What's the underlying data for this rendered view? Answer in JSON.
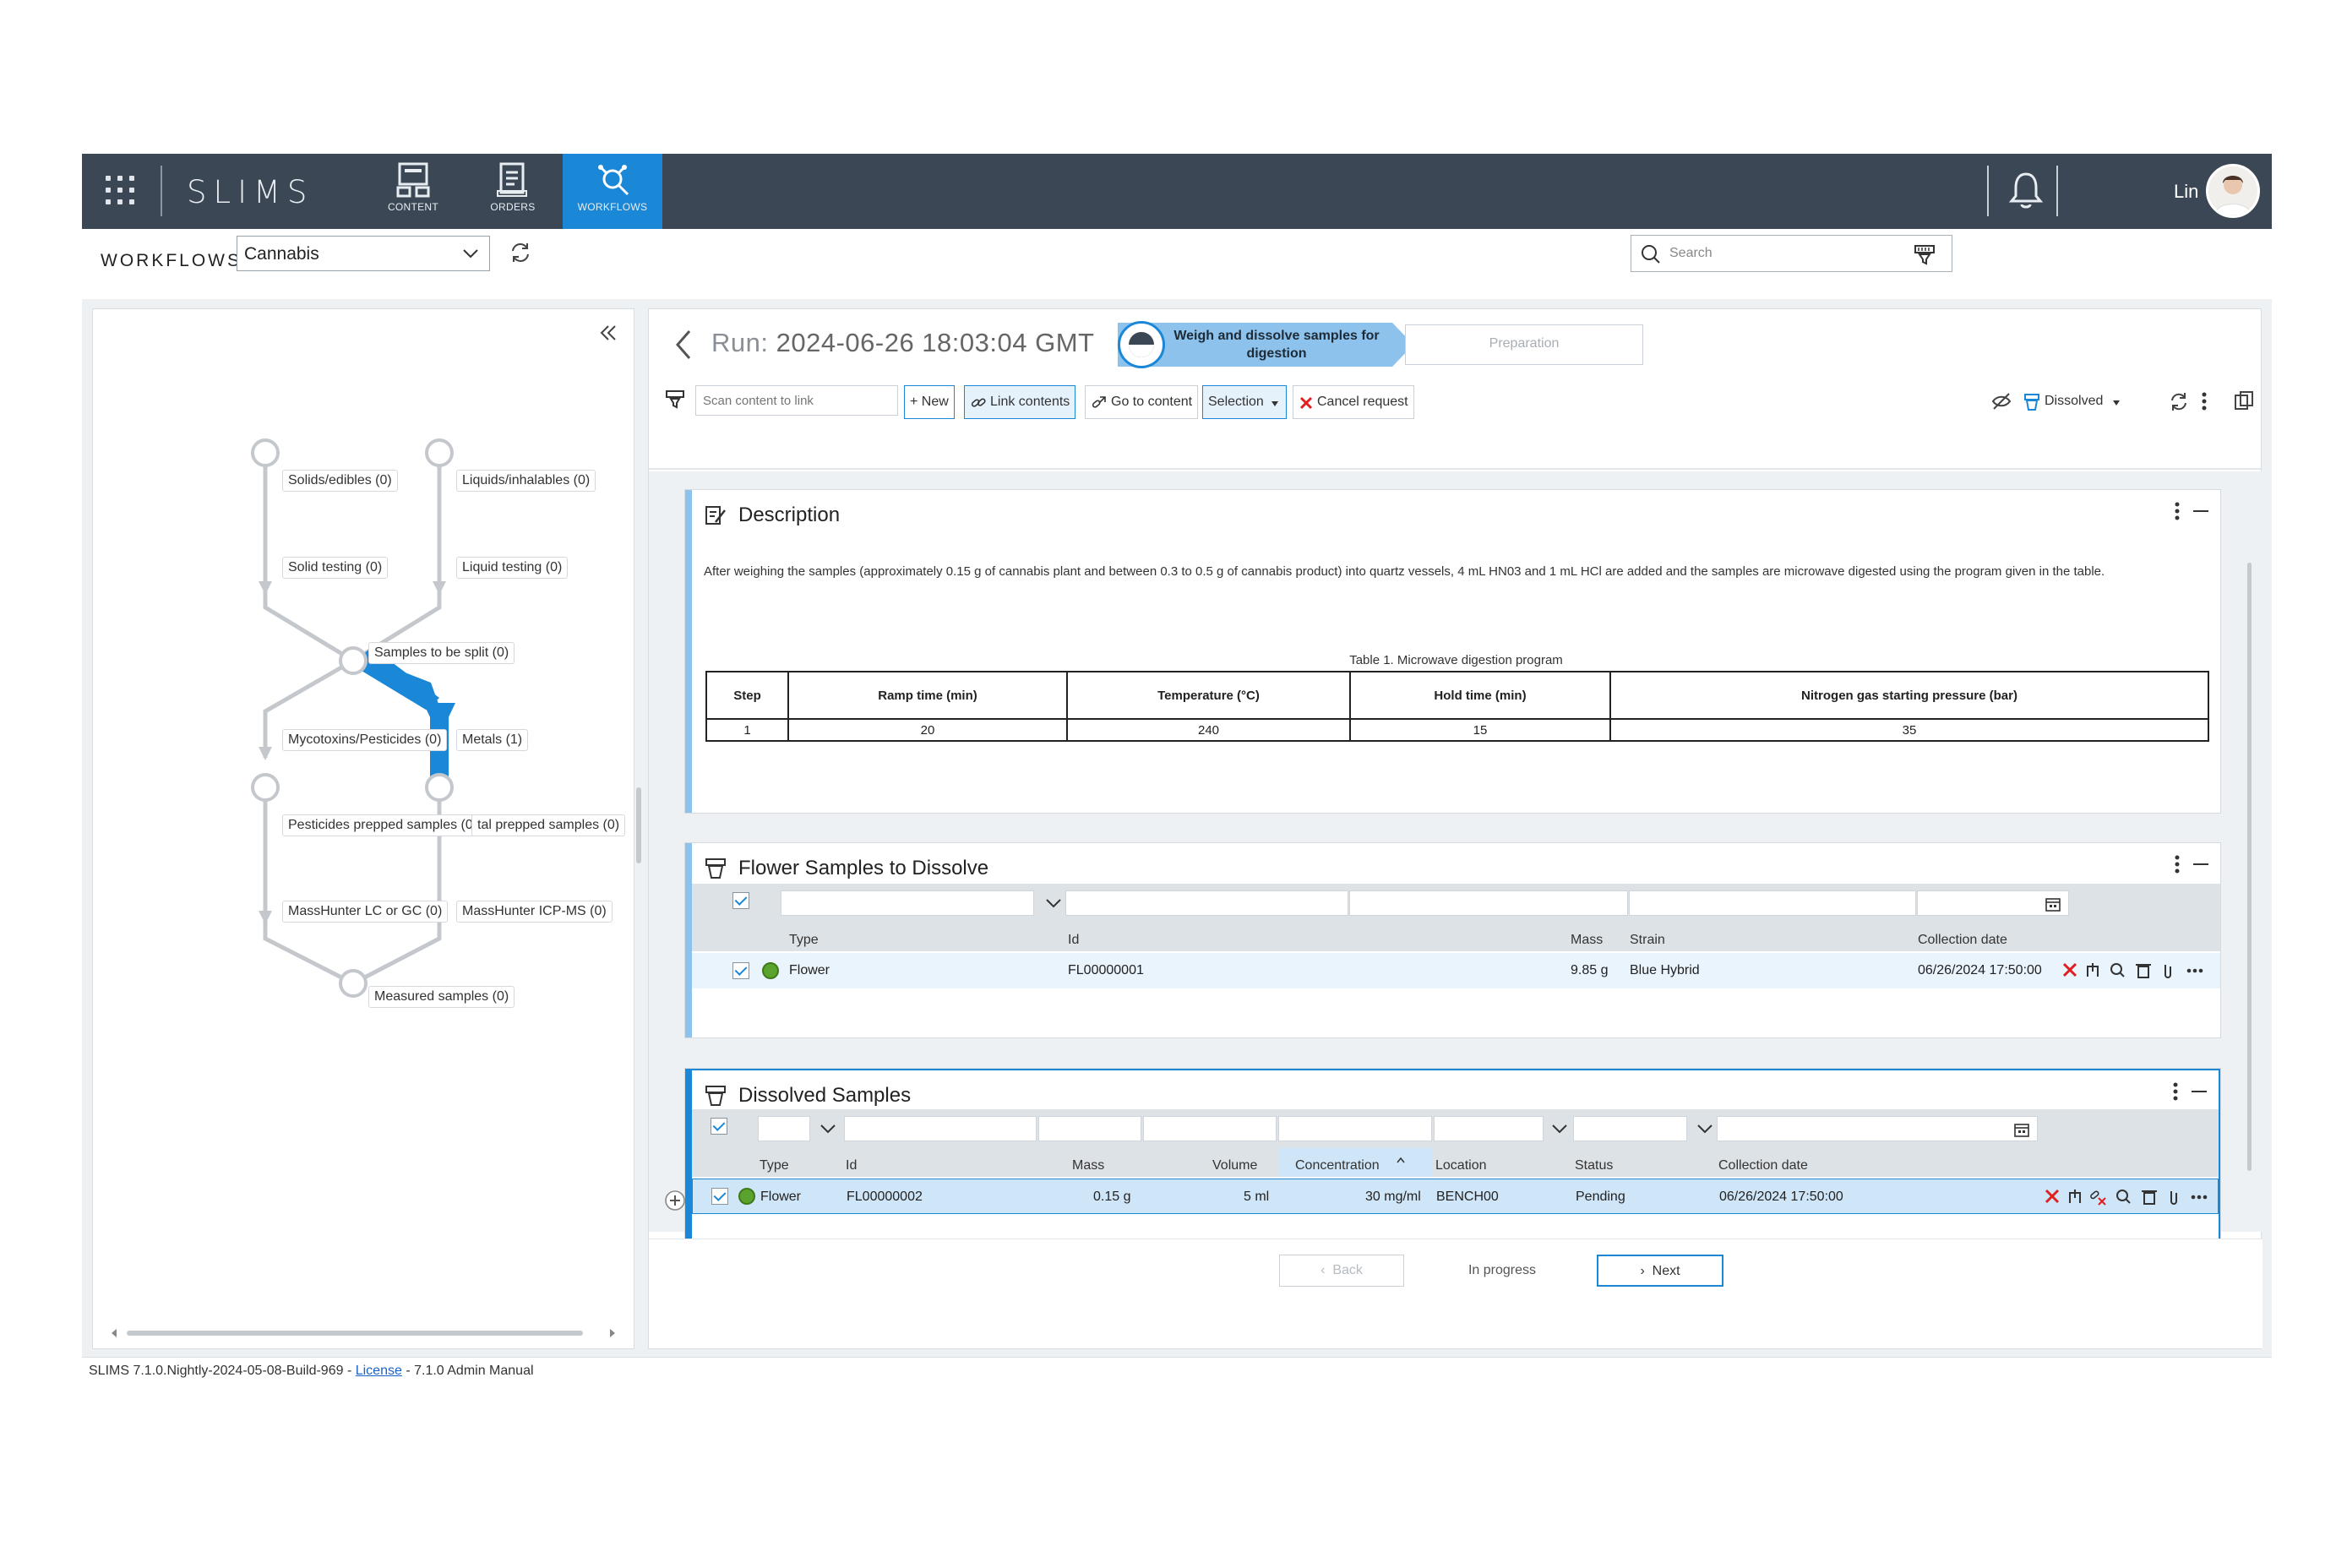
{
  "topbar": {
    "brand": "SLIMS",
    "tabs": [
      {
        "label": "CONTENT",
        "icon": "content-icon"
      },
      {
        "label": "ORDERS",
        "icon": "orders-icon"
      },
      {
        "label": "WORKFLOWS",
        "icon": "workflows-icon"
      }
    ],
    "active_tab": "WORKFLOWS",
    "user_name": "Lin"
  },
  "subheader": {
    "label": "WORKFLOWS",
    "selected_workflow": "Cannabis",
    "search_placeholder": "Search"
  },
  "workflow_graph": {
    "nodes": [
      {
        "label": "Solids/edibles (0)"
      },
      {
        "label": "Liquids/inhalables (0)"
      },
      {
        "label": "Solid testing (0)"
      },
      {
        "label": "Liquid testing (0)"
      },
      {
        "label": "Samples to be split (0)"
      },
      {
        "label": "Mycotoxins/Pesticides (0)"
      },
      {
        "label": "Metals (1)"
      },
      {
        "label": "Pesticides prepped samples (0)"
      },
      {
        "label": "tal prepped samples (0)"
      },
      {
        "label": "MassHunter LC or GC (0)"
      },
      {
        "label": "MassHunter ICP-MS (0)"
      },
      {
        "label": "Measured samples (0)"
      }
    ]
  },
  "run": {
    "prefix": "Run:",
    "datetime": "2024-06-26 18:03:04 GMT",
    "current_step": "Weigh and dissolve samples for digestion",
    "next_step": "Preparation"
  },
  "toolbar": {
    "scan_placeholder": "Scan content to link",
    "new_label": "+ New",
    "link_contents_label": "Link contents",
    "go_to_content_label": "Go to content",
    "selection_label": "Selection",
    "cancel_request_label": "Cancel request",
    "status_dropdown_label": "Dissolved"
  },
  "description_card": {
    "title": "Description",
    "text": "After weighing the samples (approximately 0.15 g of cannabis plant and between 0.3 to 0.5 g of cannabis product) into quartz vessels, 4 mL HN03 and 1 mL HCl are added and the samples are microwave digested using the program given in the table.",
    "table_caption": "Table 1. Microwave digestion program",
    "table_headers": [
      "Step",
      "Ramp time (min)",
      "Temperature (°C)",
      "Hold time (min)",
      "Nitrogen gas starting pressure (bar)"
    ],
    "table_rows": [
      [
        "1",
        "20",
        "240",
        "15",
        "35"
      ]
    ]
  },
  "flower_card": {
    "title": "Flower Samples to Dissolve",
    "columns": [
      "Type",
      "Id",
      "Mass",
      "Strain",
      "Collection date"
    ],
    "rows": [
      {
        "type": "Flower",
        "id": "FL00000001",
        "mass": "9.85 g",
        "strain": "Blue Hybrid",
        "collection_date": "06/26/2024 17:50:00"
      }
    ]
  },
  "dissolved_card": {
    "title": "Dissolved Samples",
    "columns": [
      "Type",
      "Id",
      "Mass",
      "Volume",
      "Concentration",
      "Location",
      "Status",
      "Collection date"
    ],
    "rows": [
      {
        "type": "Flower",
        "id": "FL00000002",
        "mass": "0.15 g",
        "volume": "5 ml",
        "concentration": "30 mg/ml",
        "location": "BENCH00",
        "status": "Pending",
        "collection_date": "06/26/2024 17:50:00"
      }
    ]
  },
  "footer_nav": {
    "back_label": "Back",
    "progress_label": "In progress",
    "next_label": "Next"
  },
  "status_bar": {
    "version": "SLIMS 7.1.0.Nightly-2024-05-08-Build-969 - ",
    "license_link": "License",
    "manual": " - 7.1.0 Admin Manual"
  },
  "colors": {
    "topbar_bg": "#3b4755",
    "accent": "#1a87d7",
    "step_fill": "#8cc2ec",
    "remove_red": "#e02020"
  }
}
